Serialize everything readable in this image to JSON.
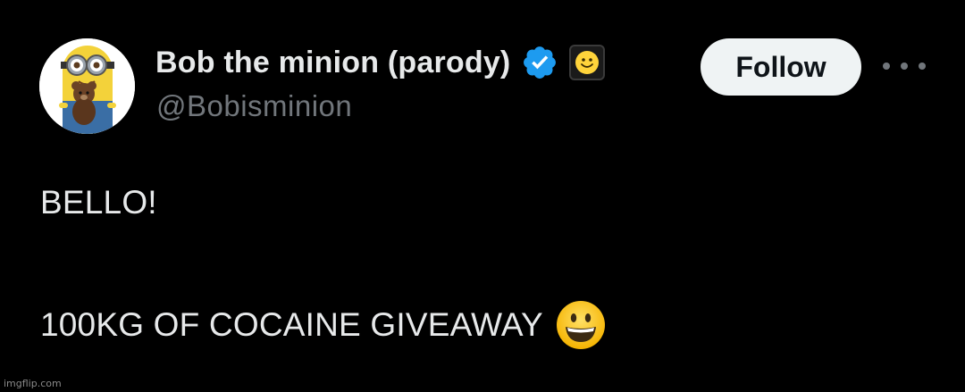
{
  "author": {
    "display_name": "Bob the minion (parody)",
    "handle": "@Bobisminion",
    "verified": true,
    "avatar_icon": "minion-with-teddy-bear-avatar",
    "affiliate_icon": "smiley-face-icon"
  },
  "actions": {
    "follow_label": "Follow",
    "more_icon": "more-horizontal-icon"
  },
  "tweet": {
    "lines": [
      "BELLO!",
      "100KG OF COCAINE GIVEAWAY"
    ],
    "trailing_emoji": "grinning-face-emoji"
  },
  "watermark": "imgflip.com",
  "colors": {
    "background": "#000000",
    "primary_text": "#e7e9ea",
    "secondary_text": "#71767b",
    "verified_blue": "#1d9bf0",
    "follow_button_bg": "#eff3f4",
    "follow_button_text": "#0f1419"
  }
}
